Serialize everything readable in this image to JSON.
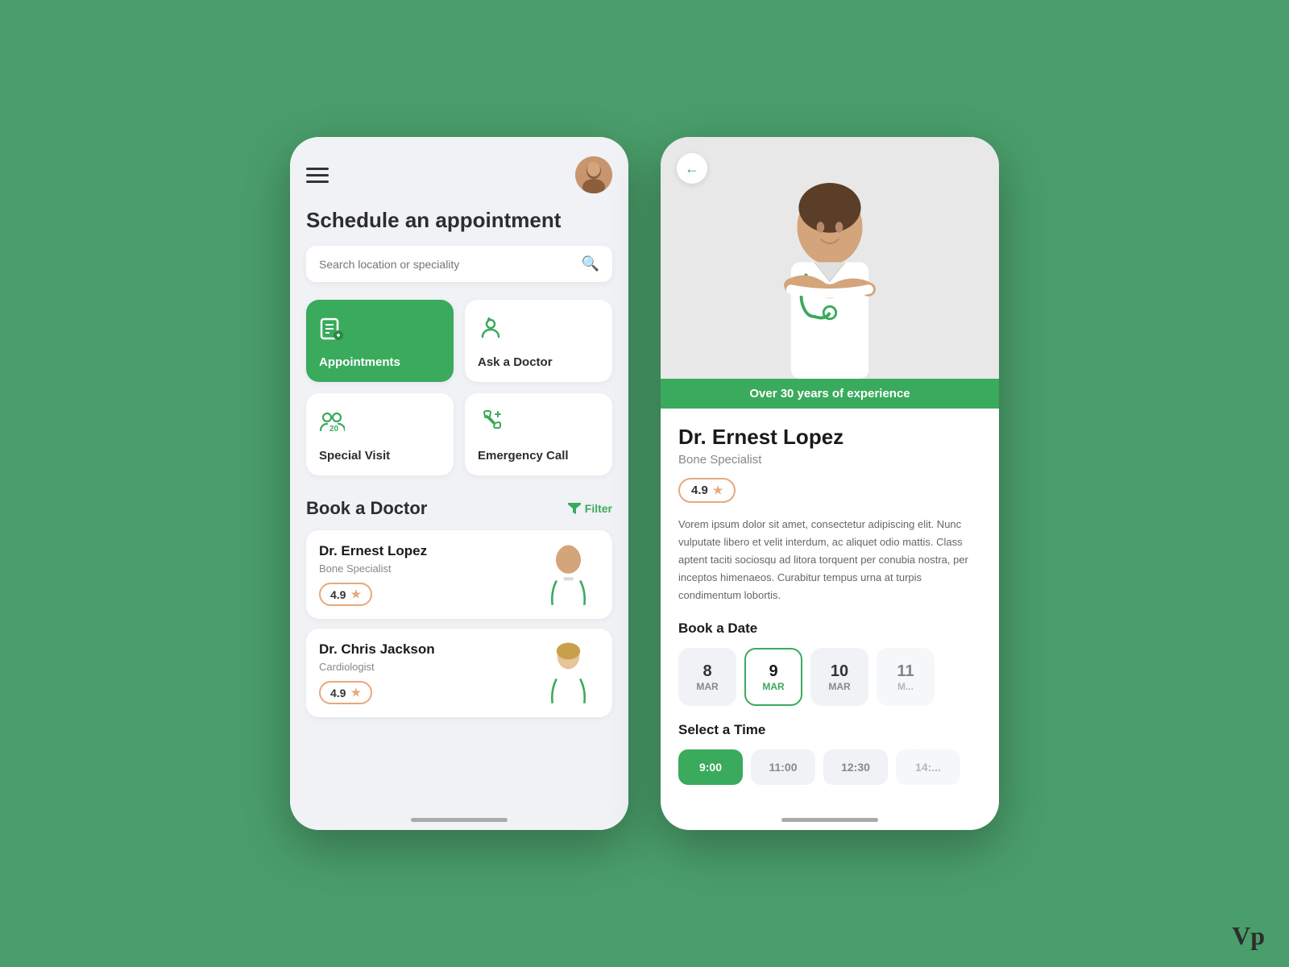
{
  "app": {
    "background": "#4a9e6b",
    "watermark": "Vp"
  },
  "left_phone": {
    "title": "Schedule an appointment",
    "search": {
      "placeholder": "Search location or speciality"
    },
    "grid_cards": [
      {
        "id": "appointments",
        "label": "Appointments",
        "icon": "📋",
        "active": true
      },
      {
        "id": "ask-doctor",
        "label": "Ask a Doctor",
        "icon": "👨‍⚕️",
        "active": false
      },
      {
        "id": "special-visit",
        "label": "Special Visit",
        "icon": "👥",
        "active": false
      },
      {
        "id": "emergency-call",
        "label": "Emergency Call",
        "icon": "📞",
        "active": false
      }
    ],
    "book_section": {
      "title": "Book a Doctor",
      "filter_label": "Filter"
    },
    "doctors": [
      {
        "name": "Dr. Ernest Lopez",
        "specialty": "Bone Specialist",
        "rating": "4.9"
      },
      {
        "name": "Dr. Chris Jackson",
        "specialty": "Cardiologist",
        "rating": "4.9"
      }
    ]
  },
  "right_phone": {
    "back_label": "←",
    "experience_banner": "Over 30 years of experience",
    "doctor": {
      "name": "Dr. Ernest Lopez",
      "specialty": "Bone Specialist",
      "rating": "4.9",
      "bio": "Vorem ipsum dolor sit amet, consectetur adipiscing elit. Nunc vulputate libero et velit interdum, ac aliquet odio mattis. Class aptent taciti sociosqu ad litora torquent per conubia nostra, per inceptos himenaeos. Curabitur tempus urna at turpis condimentum lobortis."
    },
    "book_date_title": "Book a Date",
    "dates": [
      {
        "num": "8",
        "mon": "MAR",
        "selected": false
      },
      {
        "num": "9",
        "mon": "MAR",
        "selected": true
      },
      {
        "num": "10",
        "mon": "MAR",
        "selected": false
      },
      {
        "num": "11",
        "mon": "M...",
        "selected": false,
        "partial": true
      }
    ],
    "select_time_title": "Select a Time",
    "times": [
      {
        "value": "9:00",
        "selected": true
      },
      {
        "value": "11:00",
        "selected": false
      },
      {
        "value": "12:30",
        "selected": false
      },
      {
        "value": "14:...",
        "selected": false,
        "partial": true
      }
    ]
  }
}
